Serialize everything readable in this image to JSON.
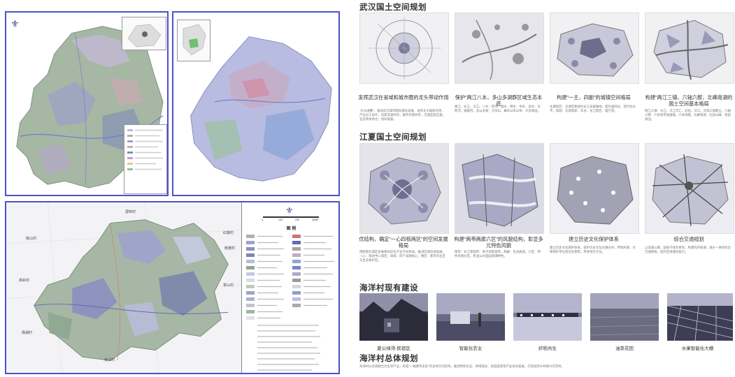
{
  "colors": {
    "frame": "#4f4fc9",
    "map_purple": "#9a98c4",
    "map_green": "#8fae94",
    "text": "#333333"
  },
  "left_maps": {
    "top_left": {
      "logo_icon": "fleur-logo-icon"
    },
    "top_right": {
      "logo_icon": "fleur-logo-icon"
    },
    "bottom": {
      "logo_icon": "fleur-logo-icon",
      "legend_title": "图  例",
      "scale_ticks": [
        "0",
        "100",
        "200",
        "300M"
      ],
      "village_labels": [
        "邵林村",
        "院山村",
        "红旗村",
        "南港村",
        "茶山村",
        "高岭村",
        "杨湖村",
        "长江村"
      ]
    }
  },
  "wuhan": {
    "title": "武汉国土空间规划",
    "items": [
      {
        "caption": "发挥武汉在省域和城市圈的龙头带动作用",
        "text": "\"九州通衢\"，推动武汉城市圈同城化发展，发挥龙头辐射作用，产业分工协作，创新资源共享，服务共建共享，交通互联互通，生态共保共治，协同发展。"
      },
      {
        "caption": "保护\"两江八水，多山多湖群区域生态本底",
        "text": "两江：长江、汉江。八水：府河、滠水、倒水、举水、金水、东荆河、通顺河。多山多湖：大别山、幕阜山等山体，众多湖泊。"
      },
      {
        "caption": "构建\"一主，四副\"的城镇空间格局",
        "text": "主城地区：主城区要依托长江发展轴线，提升国际化、现代化水平。四副：东湖高新、车谷、长江新区、临空港。"
      },
      {
        "caption": "构建\"两江三镇，六轴六楔，北峰南湖的国土空间基本格局",
        "text": "两江三镇：长江、汉江交汇，武昌、汉口、汉阳三镇鼎立。六轴六楔：六条城市发展轴，六条绿楔。北峰南湖：北部山峰、南部湖泊。"
      }
    ]
  },
  "jiangxia": {
    "title": "江夏国土空间规划",
    "items": [
      {
        "caption": "优结构，确定\"一心四核两区\"的空间发展格局",
        "text": "围绕南北城区发展格局优化产业空间布局，推进区域协调发展，一心：纸坊中心城区；四核：四个发展核心；两区：都市农业区与生态保护区。"
      },
      {
        "caption": "构建\"两带两廊六区\"的风貌结构，彰显多元特色风貌",
        "text": "两带：长江景观带、梁子湖景观带。两廊：生态廊道。六区：特色风貌分区，彰显山水田园城镇特色。"
      },
      {
        "caption": "建立历史文化保护体系",
        "text": "建立历史文化保护体系，保护历史文化名镇名村、传统村落、文物保护单位及历史建筑，传承地方文化。"
      },
      {
        "caption": "综合交通规划",
        "text": "以高速公路、国省干线为骨架，构建内外联通、城乡一体的综合交通网络，提升区域通达能力。"
      }
    ]
  },
  "haiyang": {
    "title": "海洋村现有建设",
    "photos": [
      "夏公绿湾-民宿区",
      "智能化农业",
      "虾稻共生",
      "油菜花田",
      "水果智能化大棚"
    ]
  },
  "overall": {
    "title": "海洋村总体规划",
    "text": "海洋村以农旅融合为主导产业，形成\"一轴两带多区\"的总体空间结构，推进特色农业、休闲观光、民宿度假等产业协同发展，打造城郊乡村振兴示范村。"
  }
}
